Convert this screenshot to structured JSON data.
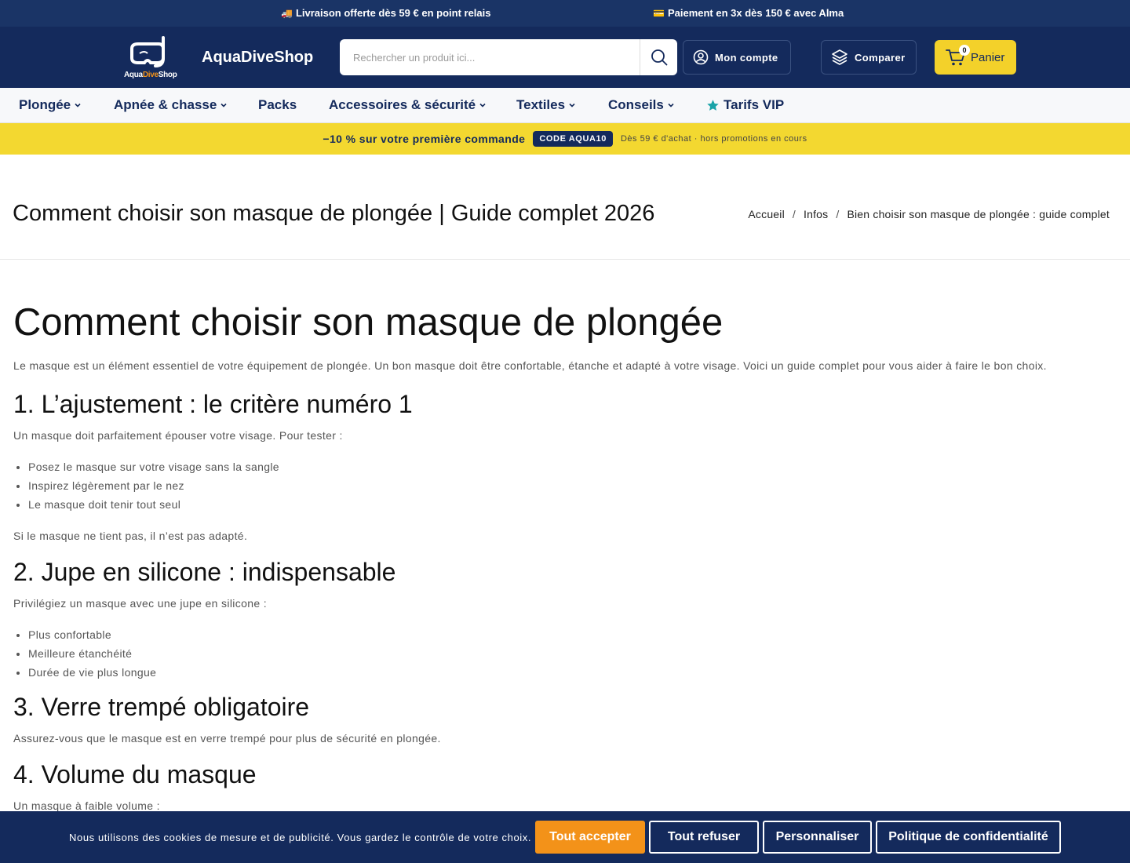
{
  "topbar": {
    "shipping": "Livraison offerte dès 59 € en point relais",
    "payment": "Paiement en 3x dès 150 € avec Alma"
  },
  "header": {
    "logo_text_1": "Aqua",
    "logo_text_2": "Dive",
    "logo_text_3": "Shop",
    "brand": "AquaDiveShop",
    "search_placeholder": "Rechercher un produit ici...",
    "account_label": "Mon compte",
    "compare_label": "Comparer",
    "cart_label": "Panier",
    "cart_count": "0"
  },
  "nav": {
    "items": [
      {
        "label": "Plongée"
      },
      {
        "label": "Apnée & chasse"
      },
      {
        "label": "Packs"
      },
      {
        "label": "Accessoires & sécurité"
      },
      {
        "label": "Textiles"
      },
      {
        "label": "Conseils"
      },
      {
        "label": "Tarifs VIP"
      }
    ]
  },
  "promo": {
    "text": "−10 % sur votre première commande",
    "code": "CODE AQUA10",
    "note": "Dès 59 € d'achat · hors promotions en cours"
  },
  "page": {
    "title": "Comment choisir son masque de plongée | Guide complet 2026",
    "breadcrumb": [
      "Accueil",
      "Infos",
      "Bien choisir son masque de plongée : guide complet"
    ],
    "breadcrumb_sep": "/"
  },
  "article": {
    "h1": "Comment choisir son masque de plongée",
    "intro": "Le masque est un élément essentiel de votre équipement de plongée. Un bon masque doit être confortable, étanche et adapté à votre visage. Voici un guide complet pour vous aider à faire le bon choix.",
    "s1_title": "1. L’ajustement : le critère numéro 1",
    "s1_text": "Un masque doit parfaitement épouser votre visage. Pour tester :",
    "s1_list": [
      "Posez le masque sur votre visage sans la sangle",
      "Inspirez légèrement par le nez",
      "Le masque doit tenir tout seul"
    ],
    "s1_after": "Si le masque ne tient pas, il n’est pas adapté.",
    "s2_title": "2. Jupe en silicone : indispensable",
    "s2_text": "Privilégiez un masque avec une jupe en silicone :",
    "s2_list": [
      "Plus confortable",
      "Meilleure étanchéité",
      "Durée de vie plus longue"
    ],
    "s3_title": "3. Verre trempé obligatoire",
    "s3_text": "Assurez-vous que le masque est en verre trempé pour plus de sécurité en plongée.",
    "s4_title": "4. Volume du masque",
    "s4_text": "Un masque à faible volume :"
  },
  "cookie": {
    "text": "Nous utilisons des cookies de mesure et de publicité. Vous gardez le contrôle de votre choix.",
    "accept": "Tout accepter",
    "refuse": "Tout refuser",
    "customize": "Personnaliser",
    "policy": "Politique de confidentialité"
  },
  "colors": {
    "navy": "#142a5c",
    "topbar": "#1a3466",
    "yellow": "#f3d830",
    "cart_yellow": "#f3d12a",
    "orange": "#f39219",
    "vip_star": "#1aa3a8"
  }
}
